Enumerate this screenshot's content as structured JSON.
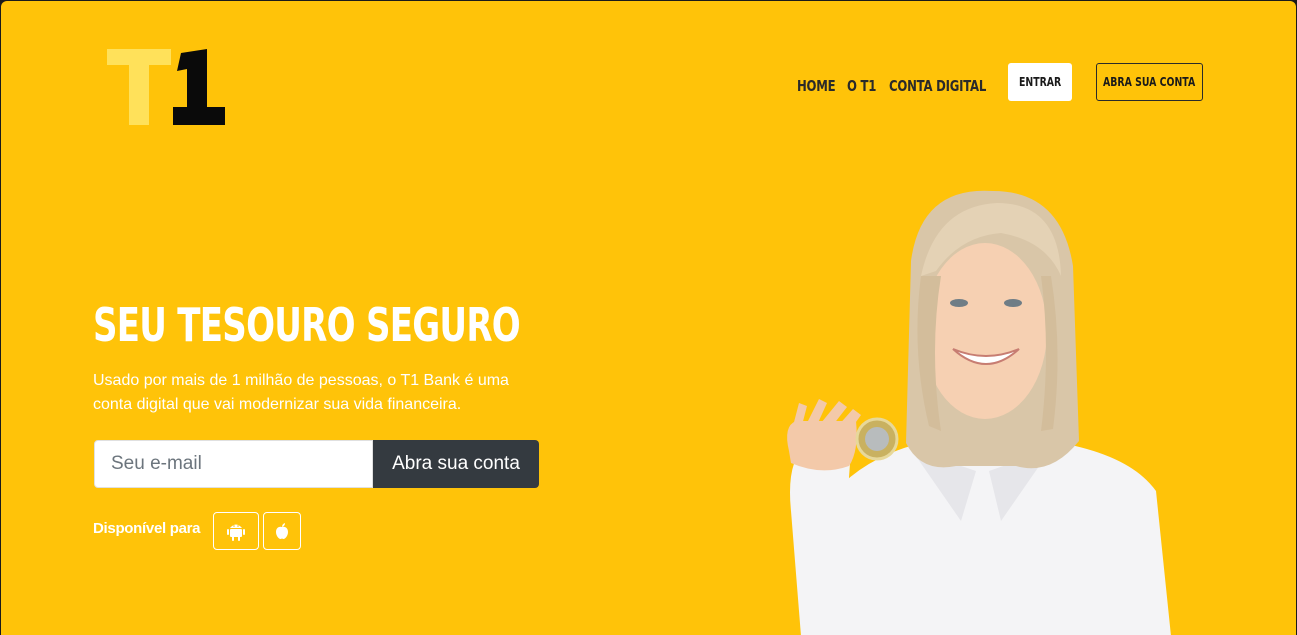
{
  "logo": {
    "text": "T1",
    "colors": {
      "t": "#ffe15a",
      "one": "#0a0a0a"
    }
  },
  "nav": {
    "items": [
      {
        "label": "HOME"
      },
      {
        "label": "O T1"
      },
      {
        "label": "CONTA DIGITAL"
      }
    ],
    "login_label": "ENTRAR",
    "open_account_label": "ABRA SUA CONTA"
  },
  "hero": {
    "title": "SEU TESOURO SEGURO",
    "subtitle": "Usado por mais de 1 milhão de pessoas, o T1 Bank é uma conta digital que vai modernizar sua vida financeira.",
    "email_placeholder": "Seu e-mail",
    "email_value": "",
    "submit_label": "Abra sua conta",
    "available_label": "Disponível para",
    "stores": [
      {
        "icon": "android-icon"
      },
      {
        "icon": "apple-icon"
      }
    ]
  },
  "colors": {
    "background": "#ffc309",
    "dark_button": "#343a40",
    "white": "#ffffff"
  }
}
